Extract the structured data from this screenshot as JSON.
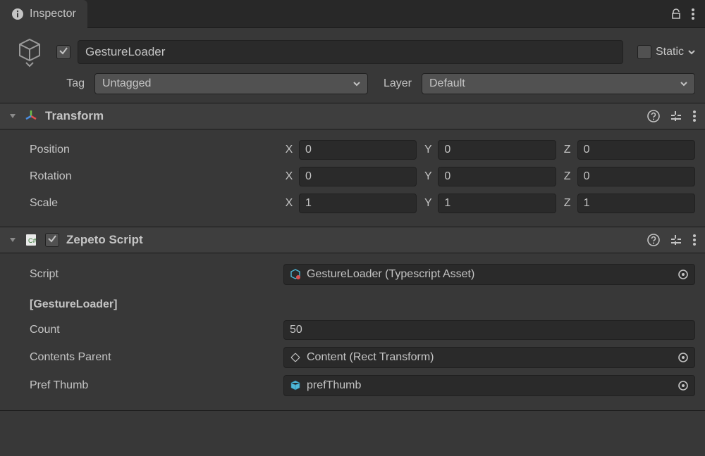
{
  "tab": {
    "title": "Inspector"
  },
  "header": {
    "enabled": true,
    "name": "GestureLoader",
    "static_label": "Static",
    "tag_label": "Tag",
    "tag_value": "Untagged",
    "layer_label": "Layer",
    "layer_value": "Default"
  },
  "transform": {
    "title": "Transform",
    "position_label": "Position",
    "rotation_label": "Rotation",
    "scale_label": "Scale",
    "x_label": "X",
    "y_label": "Y",
    "z_label": "Z",
    "position": {
      "x": "0",
      "y": "0",
      "z": "0"
    },
    "rotation": {
      "x": "0",
      "y": "0",
      "z": "0"
    },
    "scale": {
      "x": "1",
      "y": "1",
      "z": "1"
    }
  },
  "zepeto": {
    "title": "Zepeto Script",
    "script_label": "Script",
    "script_value": "GestureLoader (Typescript Asset)",
    "section_label": "[GestureLoader]",
    "count_label": "Count",
    "count_value": "50",
    "contents_parent_label": "Contents Parent",
    "contents_parent_value": "Content (Rect Transform)",
    "pref_thumb_label": "Pref Thumb",
    "pref_thumb_value": "prefThumb"
  }
}
